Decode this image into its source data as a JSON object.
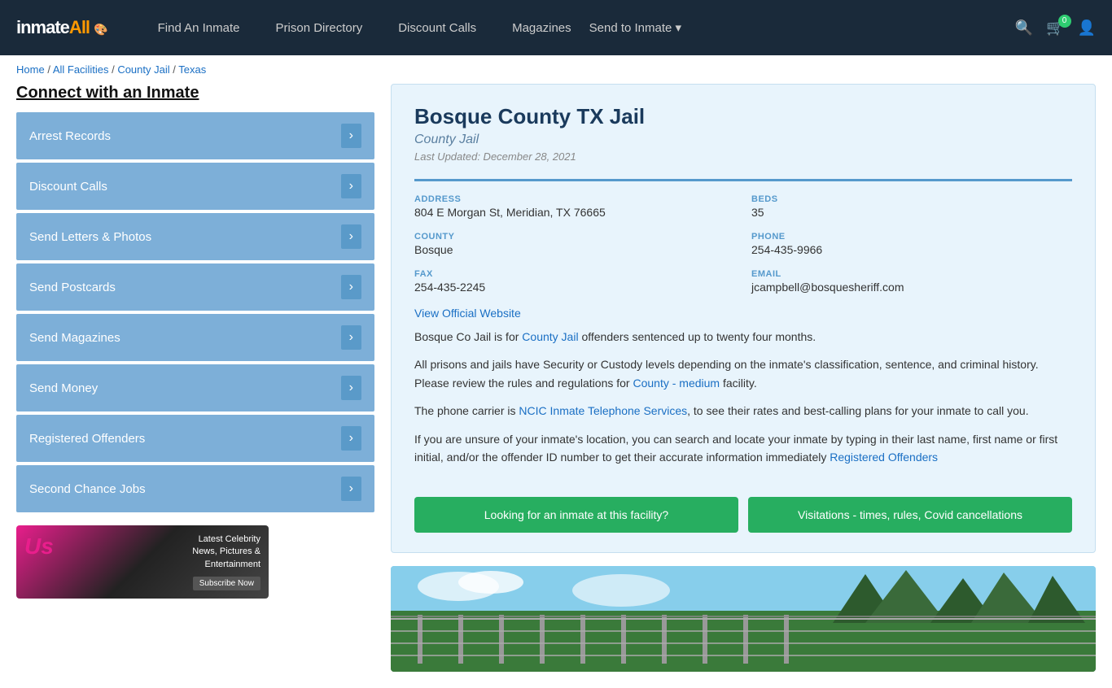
{
  "nav": {
    "logo_text": "inmateA",
    "logo_highlight": "ll",
    "links": [
      {
        "label": "Find An Inmate",
        "id": "find-inmate"
      },
      {
        "label": "Prison Directory",
        "id": "prison-directory"
      },
      {
        "label": "Discount Calls",
        "id": "discount-calls"
      },
      {
        "label": "Magazines",
        "id": "magazines"
      },
      {
        "label": "Send to Inmate ▾",
        "id": "send-to-inmate"
      }
    ],
    "cart_count": "0"
  },
  "breadcrumb": {
    "home": "Home",
    "all_facilities": "All Facilities",
    "county_jail": "County Jail",
    "state": "Texas"
  },
  "sidebar": {
    "title": "Connect with an Inmate",
    "items": [
      {
        "label": "Arrest Records"
      },
      {
        "label": "Discount Calls"
      },
      {
        "label": "Send Letters & Photos"
      },
      {
        "label": "Send Postcards"
      },
      {
        "label": "Send Magazines"
      },
      {
        "label": "Send Money"
      },
      {
        "label": "Registered Offenders"
      },
      {
        "label": "Second Chance Jobs"
      }
    ],
    "ad": {
      "logo": "Us",
      "line1": "Latest Celebrity",
      "line2": "News, Pictures &",
      "line3": "Entertainment",
      "btn": "Subscribe Now"
    }
  },
  "facility": {
    "title": "Bosque County TX Jail",
    "subtitle": "County Jail",
    "updated": "Last Updated: December 28, 2021",
    "address_label": "ADDRESS",
    "address_value": "804 E Morgan St, Meridian, TX 76665",
    "beds_label": "BEDS",
    "beds_value": "35",
    "county_label": "COUNTY",
    "county_value": "Bosque",
    "phone_label": "PHONE",
    "phone_value": "254-435-9966",
    "fax_label": "FAX",
    "fax_value": "254-435-2245",
    "email_label": "EMAIL",
    "email_value": "jcampbell@bosquesheriff.com",
    "website_link": "View Official Website",
    "desc1": "Bosque Co Jail is for County Jail offenders sentenced up to twenty four months.",
    "desc2": "All prisons and jails have Security or Custody levels depending on the inmate's classification, sentence, and criminal history. Please review the rules and regulations for County - medium facility.",
    "desc3": "The phone carrier is NCIC Inmate Telephone Services, to see their rates and best-calling plans for your inmate to call you.",
    "desc4": "If you are unsure of your inmate's location, you can search and locate your inmate by typing in their last name, first name or first initial, and/or the offender ID number to get their accurate information immediately Registered Offenders",
    "btn1": "Looking for an inmate at this facility?",
    "btn2": "Visitations - times, rules, Covid cancellations"
  }
}
